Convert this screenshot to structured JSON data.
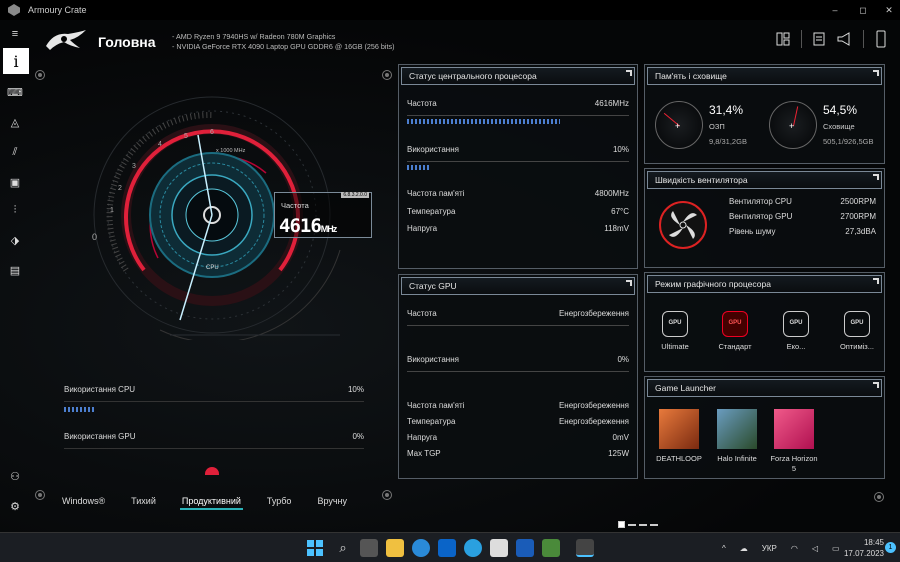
{
  "window": {
    "title": "Armoury Crate",
    "controls": {
      "minimize": "–",
      "maximize": "◻",
      "close": "✕"
    }
  },
  "header": {
    "title": "Головна",
    "cpu_info": "-  AMD Ryzen 9 7940HS w/ Radeon 780M Graphics",
    "gpu_info": "-  NVIDIA GeForce RTX 4090 Laptop GPU GDDR6 @ 16GB (256 bits)"
  },
  "sidebar": {
    "items": [
      {
        "name": "menu-icon",
        "glyph": "≡"
      },
      {
        "name": "home-info-icon",
        "glyph": "i"
      },
      {
        "name": "keyboard-icon",
        "glyph": "⌨"
      },
      {
        "name": "aura-icon",
        "glyph": "◬"
      },
      {
        "name": "armoury-icon",
        "glyph": "⫽"
      },
      {
        "name": "media-icon",
        "glyph": "▣"
      },
      {
        "name": "settings-sliders-icon",
        "glyph": "⫶"
      },
      {
        "name": "deals-tag-icon",
        "glyph": "⬗"
      },
      {
        "name": "news-icon",
        "glyph": "▤"
      },
      {
        "name": "user-icon",
        "glyph": "⚇"
      },
      {
        "name": "settings-icon",
        "glyph": "⚙"
      }
    ]
  },
  "gauge": {
    "scale_label": "x 1000 MHz",
    "ticks": [
      "0",
      "1",
      "2",
      "3",
      "4",
      "5",
      "6"
    ],
    "center_label": "CPU",
    "box_label": "Частота",
    "box_tag": "6.8.3.2.0.0",
    "freq_value": "4616",
    "freq_unit": "MHz"
  },
  "usage": {
    "cpu": {
      "label": "Використання CPU",
      "value": "10%",
      "fraction": 0.1
    },
    "gpu": {
      "label": "Використання GPU",
      "value": "0%",
      "fraction": 0.0
    }
  },
  "modes": [
    "Windows®",
    "Тихий",
    "Продуктивний",
    "Турбо",
    "Вручну"
  ],
  "active_mode": "Продуктивний",
  "cpu_panel": {
    "title": "Статус центрального процесора",
    "freq_label": "Частота",
    "freq_value": "4616MHz",
    "freq_fraction": 0.69,
    "usage_label": "Використання",
    "usage_value": "10%",
    "usage_fraction": 0.1,
    "mem_freq_label": "Частота пам'яті",
    "mem_freq_value": "4800MHz",
    "temp_label": "Температура",
    "temp_value": "67°C",
    "volt_label": "Напруга",
    "volt_value": "118mV"
  },
  "gpu_panel": {
    "title": "Статус GPU",
    "freq_label": "Частота",
    "freq_value": "Енергозбереження",
    "usage_label": "Використання",
    "usage_value": "0%",
    "mem_freq_label": "Частота пам'яті",
    "mem_freq_value": "Енергозбереження",
    "temp_label": "Температура",
    "temp_value": "Енергозбереження",
    "volt_label": "Напруга",
    "volt_value": "0mV",
    "tgp_label": "Max TGP",
    "tgp_value": "125W"
  },
  "memory_panel": {
    "title": "Пам'ять і сховище",
    "ram": {
      "percent": "31,4%",
      "label": "ОЗП",
      "value": "9,8/31,2GB",
      "fraction": 0.314
    },
    "storage": {
      "percent": "54,5%",
      "label": "Сховище",
      "value": "505,1/926,5GB",
      "fraction": 0.545
    }
  },
  "fan_panel": {
    "title": "Швидкість вентилятора",
    "rows": [
      {
        "label": "Вентилятор CPU",
        "value": "2500RPM"
      },
      {
        "label": "Вентилятор GPU",
        "value": "2700RPM"
      },
      {
        "label": "Рівень шуму",
        "value": "27,3dBA"
      }
    ]
  },
  "gpu_mode_panel": {
    "title": "Режим графічного процесора",
    "modes": [
      {
        "label": "Ultimate",
        "icon": "GPU",
        "active": false
      },
      {
        "label": "Стандарт",
        "icon": "GPU",
        "active": true
      },
      {
        "label": "Еко...",
        "icon": "GPU",
        "active": false
      },
      {
        "label": "Оптиміз...",
        "icon": "GPU",
        "active": false
      }
    ]
  },
  "game_panel": {
    "title": "Game Launcher",
    "games": [
      {
        "label": "DEATHLOOP",
        "color": "#c0501e"
      },
      {
        "label": "Halo Infinite",
        "color": "#3d6a8a"
      },
      {
        "label": "Forza Horizon 5",
        "color": "#d6336c"
      }
    ]
  },
  "taskbar": {
    "lang": "УКР",
    "time": "18:45",
    "date": "17.07.2023",
    "notification_count": "1"
  },
  "colors": {
    "accent_red": "#e0203a",
    "accent_teal": "#2bb2b8",
    "bar_blue": "#4c7fd0"
  }
}
